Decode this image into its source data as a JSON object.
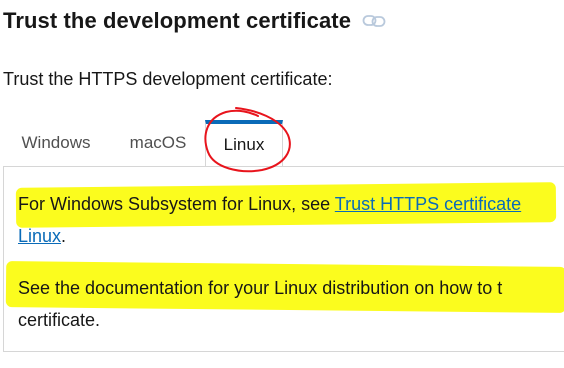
{
  "heading": {
    "title": "Trust the development certificate",
    "link_icon": "link-icon"
  },
  "intro": "Trust the HTTPS development certificate:",
  "tabs": [
    {
      "label": "Windows",
      "selected": false
    },
    {
      "label": "macOS",
      "selected": false
    },
    {
      "label": "Linux",
      "selected": true
    }
  ],
  "panel": {
    "para1_text": "For Windows Subsystem for Linux, see ",
    "para1_link": "Trust HTTPS certificate",
    "para1_link_cont": "Linux",
    "para1_end": ".",
    "para2_line1": "See the documentation for your Linux distribution on how to t",
    "para2_line2": "certificate."
  },
  "colors": {
    "accent": "#0a6bb8",
    "highlight": "#fbfc1e",
    "annotation": "#e8141c"
  }
}
